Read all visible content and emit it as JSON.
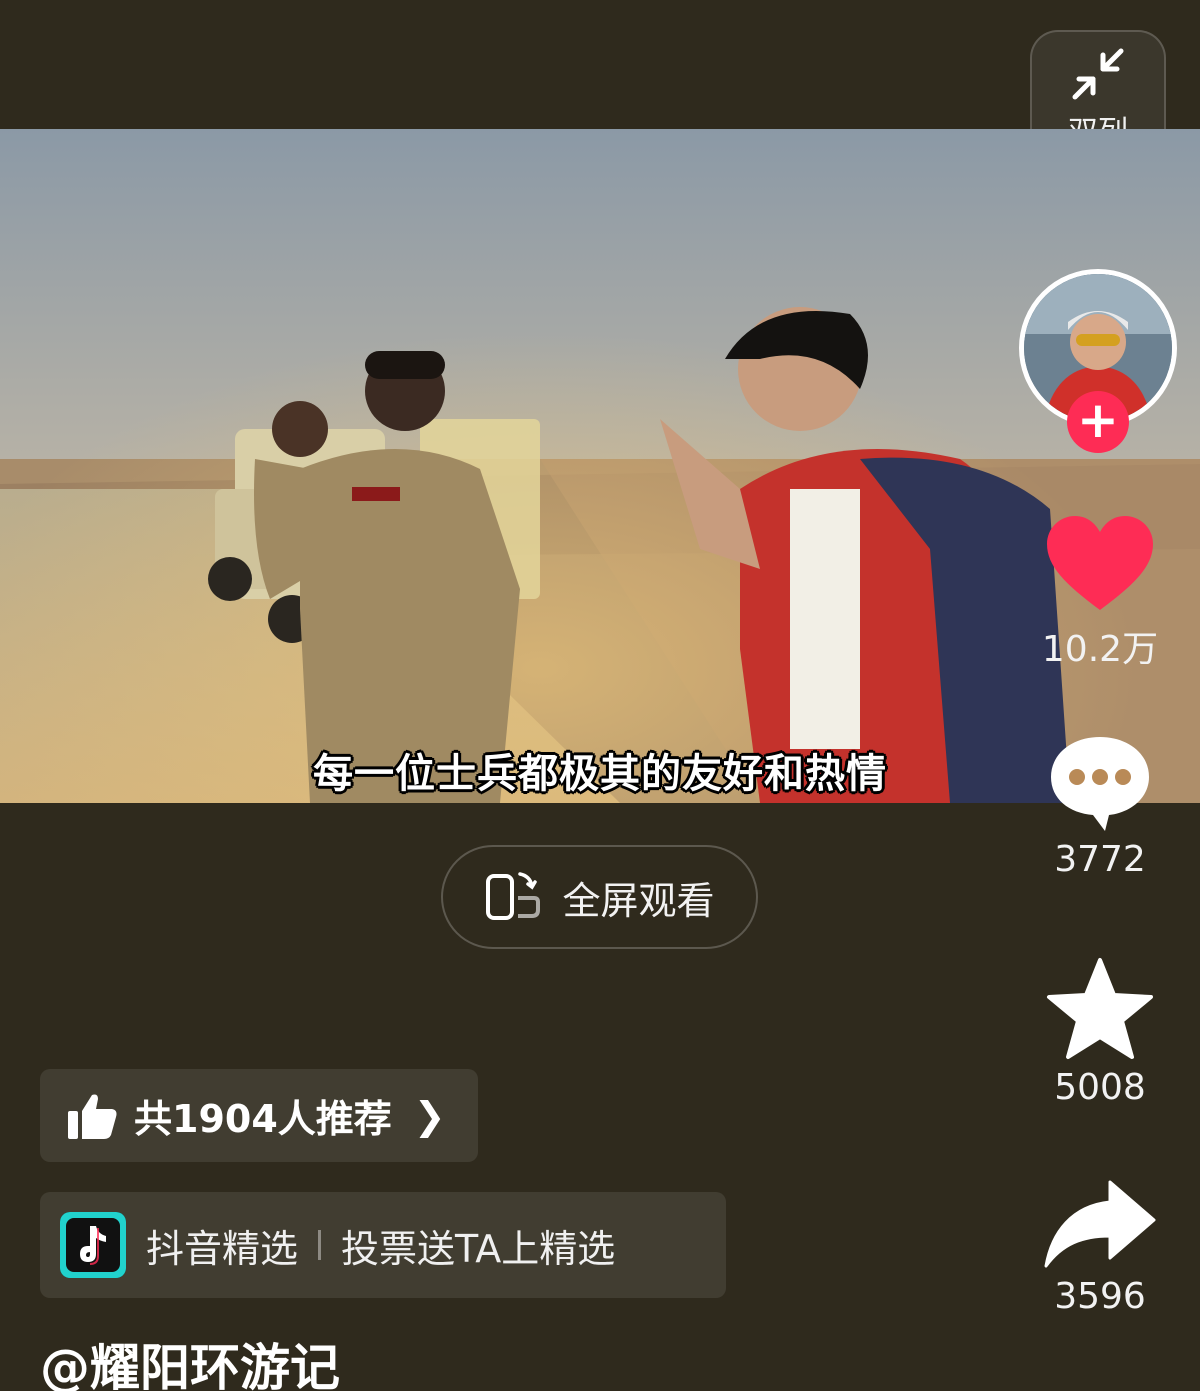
{
  "top": {
    "layout_toggle_label": "双列"
  },
  "video": {
    "subtitle": "每一位士兵都极其的友好和热情"
  },
  "fullscreen": {
    "label": "全屏观看"
  },
  "sidebar": {
    "likes": "10.2万",
    "comments": "3772",
    "favorites": "5008",
    "shares": "3596"
  },
  "recommend": {
    "text": "共1904人推荐"
  },
  "selected": {
    "brand": "抖音精选",
    "cta": "投票送TA上精选"
  },
  "author": {
    "handle": "@耀阳环游记"
  },
  "colors": {
    "background": "#2f2a1d",
    "like": "#fe2c55",
    "follow": "#fe2c55"
  }
}
